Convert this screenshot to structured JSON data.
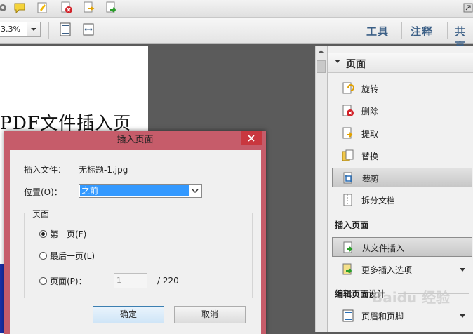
{
  "toolbar": {
    "icons": [
      "settings-icon",
      "comment-icon",
      "highlight-icon",
      "delete-page-icon",
      "extract-page-icon",
      "insert-page-icon"
    ],
    "zoom_value": "3.3%",
    "view_icons": [
      "fit-page-icon",
      "fit-width-icon"
    ],
    "links": {
      "tools": "工具",
      "comment": "注释",
      "share": "共享"
    }
  },
  "document": {
    "visible_text": "PDF文件插入页"
  },
  "right_panel": {
    "section_title": "页面",
    "items": [
      {
        "label": "旋转",
        "icon": "rotate-page-icon"
      },
      {
        "label": "删除",
        "icon": "delete-page-icon"
      },
      {
        "label": "提取",
        "icon": "extract-page-icon"
      },
      {
        "label": "替换",
        "icon": "replace-page-icon"
      },
      {
        "label": "裁剪",
        "icon": "crop-page-icon"
      },
      {
        "label": "拆分文档",
        "icon": "split-document-icon"
      }
    ],
    "insert_section": "插入页面",
    "insert_items": [
      {
        "label": "从文件插入",
        "icon": "insert-from-file-icon"
      },
      {
        "label": "更多插入选项",
        "icon": "more-insert-icon"
      }
    ],
    "edit_section": "编辑页面设计",
    "edit_items": [
      {
        "label": "页眉和页脚",
        "icon": "header-footer-icon"
      }
    ]
  },
  "dialog": {
    "title": "插入页面",
    "file_label": "插入文件：",
    "file_name": "无标题-1.jpg",
    "position_label": "位置(O)：",
    "position_value": "之前",
    "page_group_title": "页面",
    "radio_first": "第一页(F)",
    "radio_last": "最后一页(L)",
    "radio_page": "页面(P)：",
    "page_value": "1",
    "page_total": "/ 220",
    "ok": "确定",
    "cancel": "取消"
  },
  "watermark": "Baidu 经验",
  "colors": {
    "dialog_frame": "#c65c6a",
    "select_highlight": "#3399ff",
    "link_blue": "#3b5f86"
  }
}
